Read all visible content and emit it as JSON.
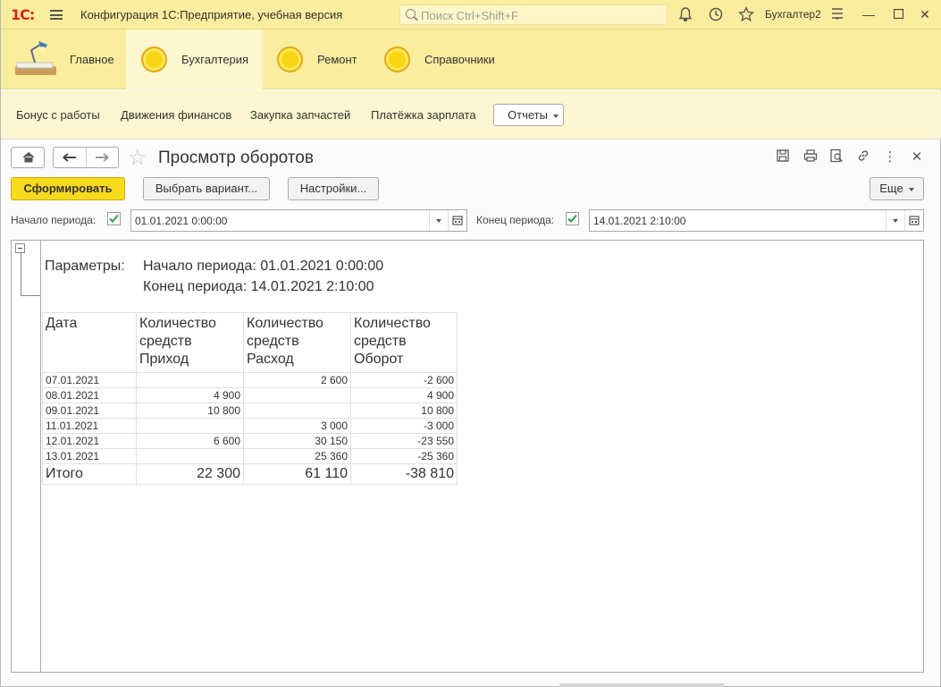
{
  "titlebar": {
    "logo": "1С:",
    "title": "Конфигурация 1С:Предприятие, учебная версия",
    "search_placeholder": "Поиск Ctrl+Shift+F",
    "user": "Бухгалтер2"
  },
  "sections": [
    {
      "label": "Главное",
      "active": false
    },
    {
      "label": "Бухгалтерия",
      "active": true
    },
    {
      "label": "Ремонт",
      "active": false
    },
    {
      "label": "Справочники",
      "active": false
    }
  ],
  "commands": {
    "links": [
      "Бонус с работы",
      "Движения финансов",
      "Закупка запчастей",
      "Платёжка зарплата"
    ],
    "reports": "Отчеты"
  },
  "form": {
    "title": "Просмотр оборотов",
    "buttons": {
      "generate": "Сформировать",
      "choose_variant": "Выбрать вариант...",
      "settings": "Настройки...",
      "more": "Еще"
    },
    "period_start_label": "Начало периода:",
    "period_start_value": "01.01.2021  0:00:00",
    "period_end_label": "Конец периода:",
    "period_end_value": "14.01.2021  2:10:00"
  },
  "report": {
    "params_label": "Параметры:",
    "param_start": "Начало периода: 01.01.2021 0:00:00",
    "param_end": "Конец периода: 14.01.2021 2:10:00",
    "headers": [
      "Дата",
      "Количество средств Приход",
      "Количество средств Расход",
      "Количество средств Оборот"
    ],
    "header_lines": [
      [
        "Дата"
      ],
      [
        "Количество",
        "средств",
        "Приход"
      ],
      [
        "Количество",
        "средств",
        "Расход"
      ],
      [
        "Количество",
        "средств",
        "Оборот"
      ]
    ],
    "rows": [
      [
        "07.01.2021",
        "",
        "2 600",
        "-2 600"
      ],
      [
        "08.01.2021",
        "4 900",
        "",
        "4 900"
      ],
      [
        "09.01.2021",
        "10 800",
        "",
        "10 800"
      ],
      [
        "11.01.2021",
        "",
        "3 000",
        "-3 000"
      ],
      [
        "12.01.2021",
        "6 600",
        "30 150",
        "-23 550"
      ],
      [
        "13.01.2021",
        "",
        "25 360",
        "-25 360"
      ]
    ],
    "total": [
      "Итого",
      "22 300",
      "61 110",
      "-38 810"
    ]
  },
  "colors": {
    "header_bg": "#fbed9e",
    "accent_button": "#f8da1e",
    "check_green": "#2e9e3f"
  }
}
